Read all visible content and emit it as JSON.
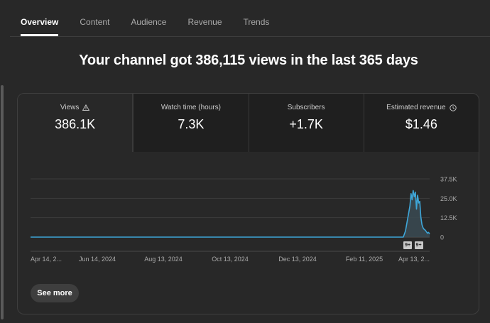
{
  "tabs": [
    {
      "label": "Overview",
      "active": true
    },
    {
      "label": "Content",
      "active": false
    },
    {
      "label": "Audience",
      "active": false
    },
    {
      "label": "Revenue",
      "active": false
    },
    {
      "label": "Trends",
      "active": false
    }
  ],
  "headline": "Your channel got 386,115 views in the last 365 days",
  "metrics": [
    {
      "label": "Views",
      "value": "386.1K",
      "icon": "warning-icon"
    },
    {
      "label": "Watch time (hours)",
      "value": "7.3K"
    },
    {
      "label": "Subscribers",
      "value": "+1.7K"
    },
    {
      "label": "Estimated revenue",
      "value": "$1.46",
      "icon": "clock-icon"
    }
  ],
  "see_more_label": "See more",
  "markers": [
    "9+",
    "9+"
  ],
  "colors": {
    "line": "#3ea6d8",
    "fill": "#3a4a52",
    "background": "#282828",
    "tile": "#1f1f1f"
  },
  "chart_data": {
    "type": "line",
    "title": "",
    "xlabel": "",
    "ylabel": "",
    "x_tick_labels": [
      "Apr 14, 2...",
      "Jun 14, 2024",
      "Aug 13, 2024",
      "Oct 13, 2024",
      "Dec 13, 2024",
      "Feb 11, 2025",
      "Apr 13, 2..."
    ],
    "y_tick_labels": [
      "37.5K",
      "25.0K",
      "12.5K",
      "0"
    ],
    "y_ticks": [
      37500,
      25000,
      12500,
      0
    ],
    "ylim": [
      0,
      37500
    ],
    "x_range": [
      "2024-04-14",
      "2025-04-13"
    ],
    "grid": true,
    "series": [
      {
        "x": [
          "2024-04-14",
          "2025-03-20",
          "2025-03-22",
          "2025-03-24",
          "2025-03-26",
          "2025-03-27",
          "2025-03-28",
          "2025-03-29",
          "2025-03-30",
          "2025-03-31",
          "2025-04-01",
          "2025-04-02",
          "2025-04-03",
          "2025-04-04",
          "2025-04-05",
          "2025-04-06",
          "2025-04-07",
          "2025-04-08",
          "2025-04-09",
          "2025-04-10",
          "2025-04-11",
          "2025-04-12",
          "2025-04-13"
        ],
        "y": [
          0,
          0,
          4000,
          12000,
          20000,
          28000,
          24000,
          30000,
          26000,
          29000,
          18000,
          27000,
          22000,
          23000,
          13000,
          8000,
          6000,
          5000,
          4500,
          3500,
          2500,
          3000,
          2000
        ]
      }
    ]
  }
}
